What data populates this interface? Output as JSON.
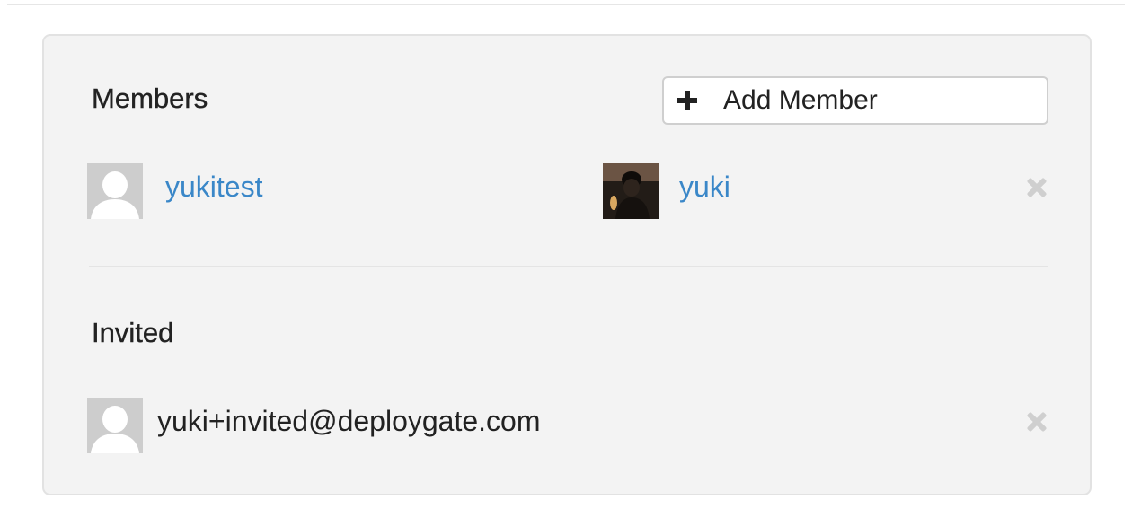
{
  "members": {
    "title": "Members",
    "add_button_label": "Add Member",
    "list": [
      {
        "name": "yukitest",
        "avatar": "default-avatar",
        "removable": false
      },
      {
        "name": "yuki",
        "avatar": "photo-avatar",
        "removable": true
      }
    ]
  },
  "invited": {
    "title": "Invited",
    "list": [
      {
        "email": "yuki+invited@deploygate.com",
        "avatar": "default-avatar",
        "removable": true
      }
    ]
  },
  "colors": {
    "link": "#3a87c8",
    "panel_background": "#f3f3f3",
    "remove_icon": "#cfcfcf"
  },
  "icons": {
    "add": "plus-icon",
    "remove": "close-icon"
  }
}
